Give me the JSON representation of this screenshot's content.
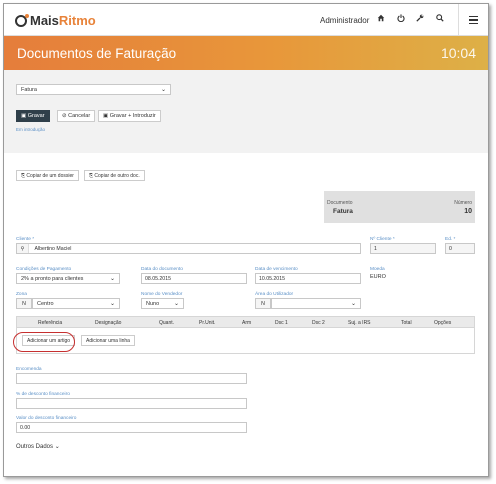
{
  "header": {
    "logo_prefix": "Mais",
    "logo_accent": "Ritmo",
    "user": "Administrador",
    "icons": [
      "home-icon",
      "power-icon",
      "wrench-icon",
      "search-icon",
      "hamburger-menu-icon"
    ]
  },
  "banner": {
    "title": "Documentos de Faturação",
    "time": "10:04"
  },
  "toolbar": {
    "doc_type": "Fatura",
    "save": "Gravar",
    "cancel": "Cancelar",
    "save_insert": "Gravar + Introduzir",
    "status": "Em introdução"
  },
  "copy_buttons": {
    "from_dossier": "Copiar de um dossier",
    "from_other": "Copiar de outro doc."
  },
  "document_box": {
    "doc_label": "Documento",
    "doc_value": "Fatura",
    "number_label": "Número",
    "number_value": "10"
  },
  "client": {
    "label": "Cliente *",
    "value": "Albertino Maciel",
    "number_label": "Nº Cliente *",
    "number_value": "1",
    "ed_label": "Ed. *",
    "ed_value": "0"
  },
  "payment": {
    "label": "Condições de Pagamento",
    "value": "2% a pronto para clientes"
  },
  "doc_date": {
    "label": "Data do documento",
    "value": "08.05.2015"
  },
  "due_date": {
    "label": "Data de vencimento",
    "value": "10.05.2015"
  },
  "currency": {
    "label": "Moeda",
    "value": "EURO"
  },
  "zone": {
    "label": "Zona",
    "code": "N",
    "value": "Centro"
  },
  "seller": {
    "label": "Nome do Vendedor",
    "value": "Nuno"
  },
  "user_area": {
    "label": "Área do Utilizador",
    "code": "N",
    "value": ""
  },
  "table": {
    "columns": [
      "Referência",
      "Designação",
      "Quant.",
      "Pr.Unit.",
      "Arm",
      "Dsc 1",
      "Dsc 2",
      "Suj. a IRS",
      "Total",
      "Opções"
    ],
    "add_article": "Adicionar um artigo",
    "add_line": "Adicionar uma linha"
  },
  "order": {
    "label": "Encomenda",
    "value": ""
  },
  "discount_pct": {
    "label": "% de desconto financeiro",
    "value": ""
  },
  "discount_value": {
    "label": "Valor do desconto financeiro",
    "value": "0.00"
  },
  "other_data": "Outros Dados",
  "colors": {
    "accent": "#e8833a",
    "banner_start": "#e57d3b",
    "banner_end": "#ddb047",
    "primary_button": "#2f3f4a",
    "label_blue": "#5a8fc6",
    "highlight_ring": "#c62f2f"
  }
}
